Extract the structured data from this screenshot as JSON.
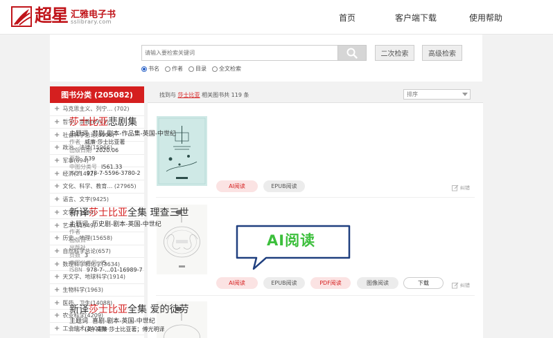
{
  "header": {
    "logo_text": "超星",
    "brand_name": "汇雅电子书",
    "brand_url": "sslibrary.com",
    "nav": [
      {
        "label": "首页"
      },
      {
        "label": "客户端下载"
      },
      {
        "label": "使用帮助"
      }
    ]
  },
  "search": {
    "placeholder": "请输入要检索关键词",
    "second_search": "二次检索",
    "advanced_search": "高级检索",
    "options": [
      {
        "label": "书名",
        "selected": true
      },
      {
        "label": "作者",
        "selected": false
      },
      {
        "label": "目录",
        "selected": false
      },
      {
        "label": "全文检索",
        "selected": false
      }
    ]
  },
  "sidebar": {
    "title": "图书分类 (205082)",
    "categories": [
      "马克思主义、列宁… (702)",
      "哲学、宗教(6972)",
      "社会科学总论(3906)",
      "政治、法律(15966)",
      "军事(694)",
      "经济(21492)",
      "文化、科学、教育… (27965)",
      "语言、文字(9425)",
      "文学(33684)",
      "艺术(11549)",
      "历史、地理(15658)",
      "自然科学总论(657)",
      "数理科学和化学(3634)",
      "天文学、地球科学(1914)",
      "生物科学(1963)",
      "医药、卫生(14088)",
      "农业科学(4209)",
      "工业技术(24018)"
    ]
  },
  "results": {
    "prefix": "找到与",
    "keyword": "莎士比亚",
    "suffix": "相关图书共 119 条",
    "sort_label": "排序"
  },
  "books": [
    {
      "title_hl": "莎士比亚",
      "title_rest": "悲剧集",
      "subject_label": "主题词",
      "subject": "悲剧-剧本-作品集-英国-中世纪",
      "author_label": "作者",
      "author": "威廉·莎士比亚著",
      "date_label": "出版日期",
      "date": "2020.06",
      "pages_label": "页数",
      "pages": "539",
      "clc_label": "中图分类号",
      "clc": "I561.33",
      "isbn_label": "ISBN",
      "isbn": "978-7-5596-3780-2",
      "btn_ai": "AI阅读",
      "btn_epub": "EPUB阅读",
      "correct": "纠错"
    },
    {
      "title_pre": "新译",
      "title_hl": "莎士比亚",
      "title_rest": "全集 理查三世",
      "subject_label": "主题词",
      "subject": "历史剧-剧本-英国-中世纪",
      "author_label": "作者",
      "date_label": "出版日",
      "publisher_label": "出版社",
      "pages_label": "页数",
      "pages": "3",
      "clc_label": "中图分类号",
      "clc": "I5",
      "isbn_label": "ISBN",
      "isbn": "978-7-…01-16989-7",
      "btn_ai": "AI阅读",
      "btn_epub": "EPUB阅读",
      "btn_pdf": "PDF阅读",
      "btn_image": "图像阅读",
      "btn_download": "下载",
      "correct": "纠错"
    },
    {
      "title_pre": "新译",
      "title_hl": "莎士比亚",
      "title_rest": "全集 爱的徒劳",
      "subject_label": "主题词",
      "subject": "喜剧-剧本-英国-中世纪",
      "author_label": "作者",
      "author": "(英) 威廉·莎士比亚著；傅光明译"
    }
  ],
  "callout": {
    "text": "AI阅读"
  }
}
